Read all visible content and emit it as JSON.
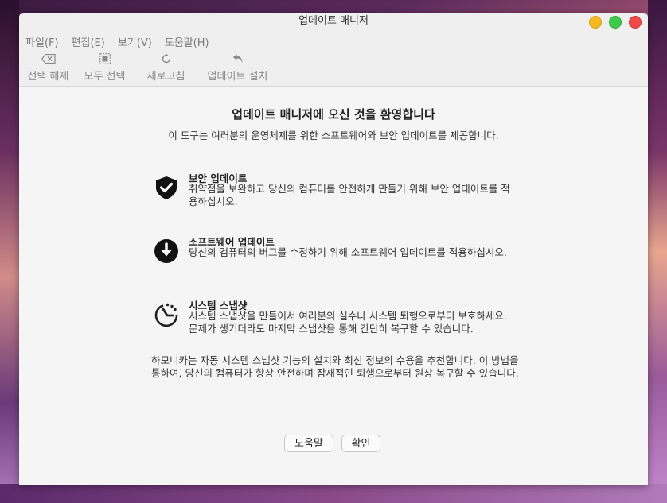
{
  "window": {
    "title": "업데이트 매니저"
  },
  "menu": [
    "파일(F)",
    "편집(E)",
    "보기(V)",
    "도움말(H)"
  ],
  "toolbar": {
    "deselect": "선택 해제",
    "select_all": "모두 선택",
    "refresh": "새로고침",
    "install": "업데이트 설치"
  },
  "welcome": {
    "title": "업데이트 매니저에 오신 것을 환영합니다",
    "subtitle": "이 도구는 여러분의 운영체제를 위한 소프트웨어와 보안 업데이트를 제공합니다."
  },
  "features": [
    {
      "icon": "shield-check-icon",
      "title": "보안 업데이트",
      "description": "취약점을 보완하고 당신의 컴퓨터를 안전하게 만들기 위해 보안 업데이트를 적용하십시오."
    },
    {
      "icon": "download-arrow-icon",
      "title": "소프트웨어 업데이트",
      "description": "당신의 컴퓨터의 버그를 수정하기 위해 소프트웨어 업데이트를 적용하십시오."
    },
    {
      "icon": "timeshift-icon",
      "title": "시스템 스냅샷",
      "description": "시스템 스냅샷을 만들어서 여러분의 실수나 시스템 퇴행으로부터 보호하세요. 문제가 생기더라도 마지막 스냅샷을 통해 간단히 복구할 수 있습니다."
    }
  ],
  "recommendation": "하모니카는 자동 시스템 스냅샷 기능의 설치와 최신 정보의 수용을 추천합니다. 이 방법을 통하여, 당신의 컴퓨터가 항상 안전하며 잠재적인 퇴행으로부터 원상 복구할 수 있습니다.",
  "buttons": {
    "help": "도움말",
    "ok": "확인"
  }
}
